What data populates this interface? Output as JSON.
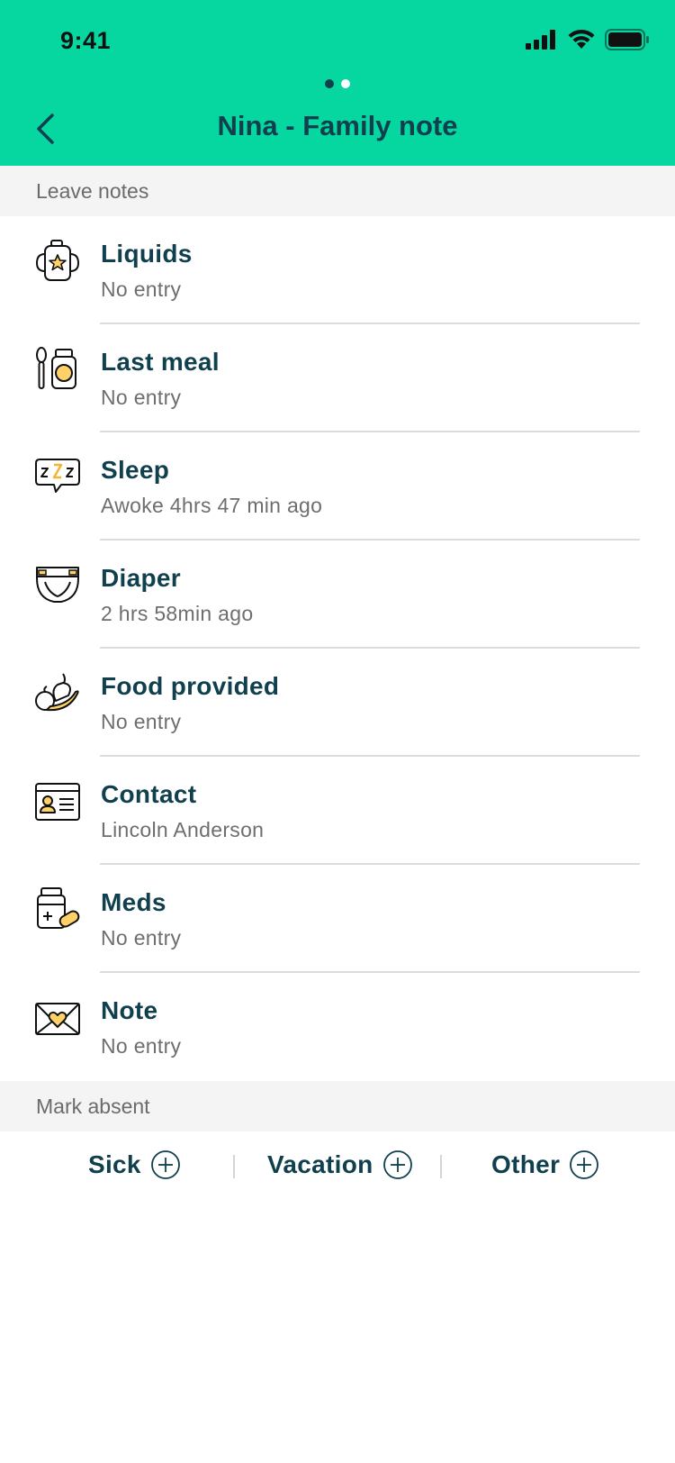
{
  "status_bar": {
    "time": "9:41"
  },
  "header": {
    "title": "Nina - Family note",
    "pages": 2,
    "active_page": 1,
    "background": "#06d6a0"
  },
  "sections": {
    "leave_notes": "Leave notes",
    "mark_absent": "Mark absent"
  },
  "items": [
    {
      "label": "Liquids",
      "value": "No entry",
      "icon": "sippy-cup-icon"
    },
    {
      "label": "Last meal",
      "value": "No entry",
      "icon": "spoon-jar-icon"
    },
    {
      "label": "Sleep",
      "value": "Awoke 4hrs 47 min ago",
      "icon": "sleep-zzz-icon"
    },
    {
      "label": "Diaper",
      "value": "2 hrs 58min ago",
      "icon": "diaper-icon"
    },
    {
      "label": "Food provided",
      "value": "No entry",
      "icon": "fruit-icon"
    },
    {
      "label": "Contact",
      "value": "Lincoln Anderson",
      "icon": "contact-card-icon"
    },
    {
      "label": "Meds",
      "value": "No entry",
      "icon": "medicine-icon"
    },
    {
      "label": "Note",
      "value": "No entry",
      "icon": "heart-envelope-icon"
    }
  ],
  "absent_options": {
    "sick": "Sick",
    "vacation": "Vacation",
    "other": "Other"
  },
  "colors": {
    "accent": "#06d6a0",
    "text_primary": "#103f4e",
    "text_secondary": "#6e6e6e",
    "icon_highlight": "#ffd166"
  }
}
